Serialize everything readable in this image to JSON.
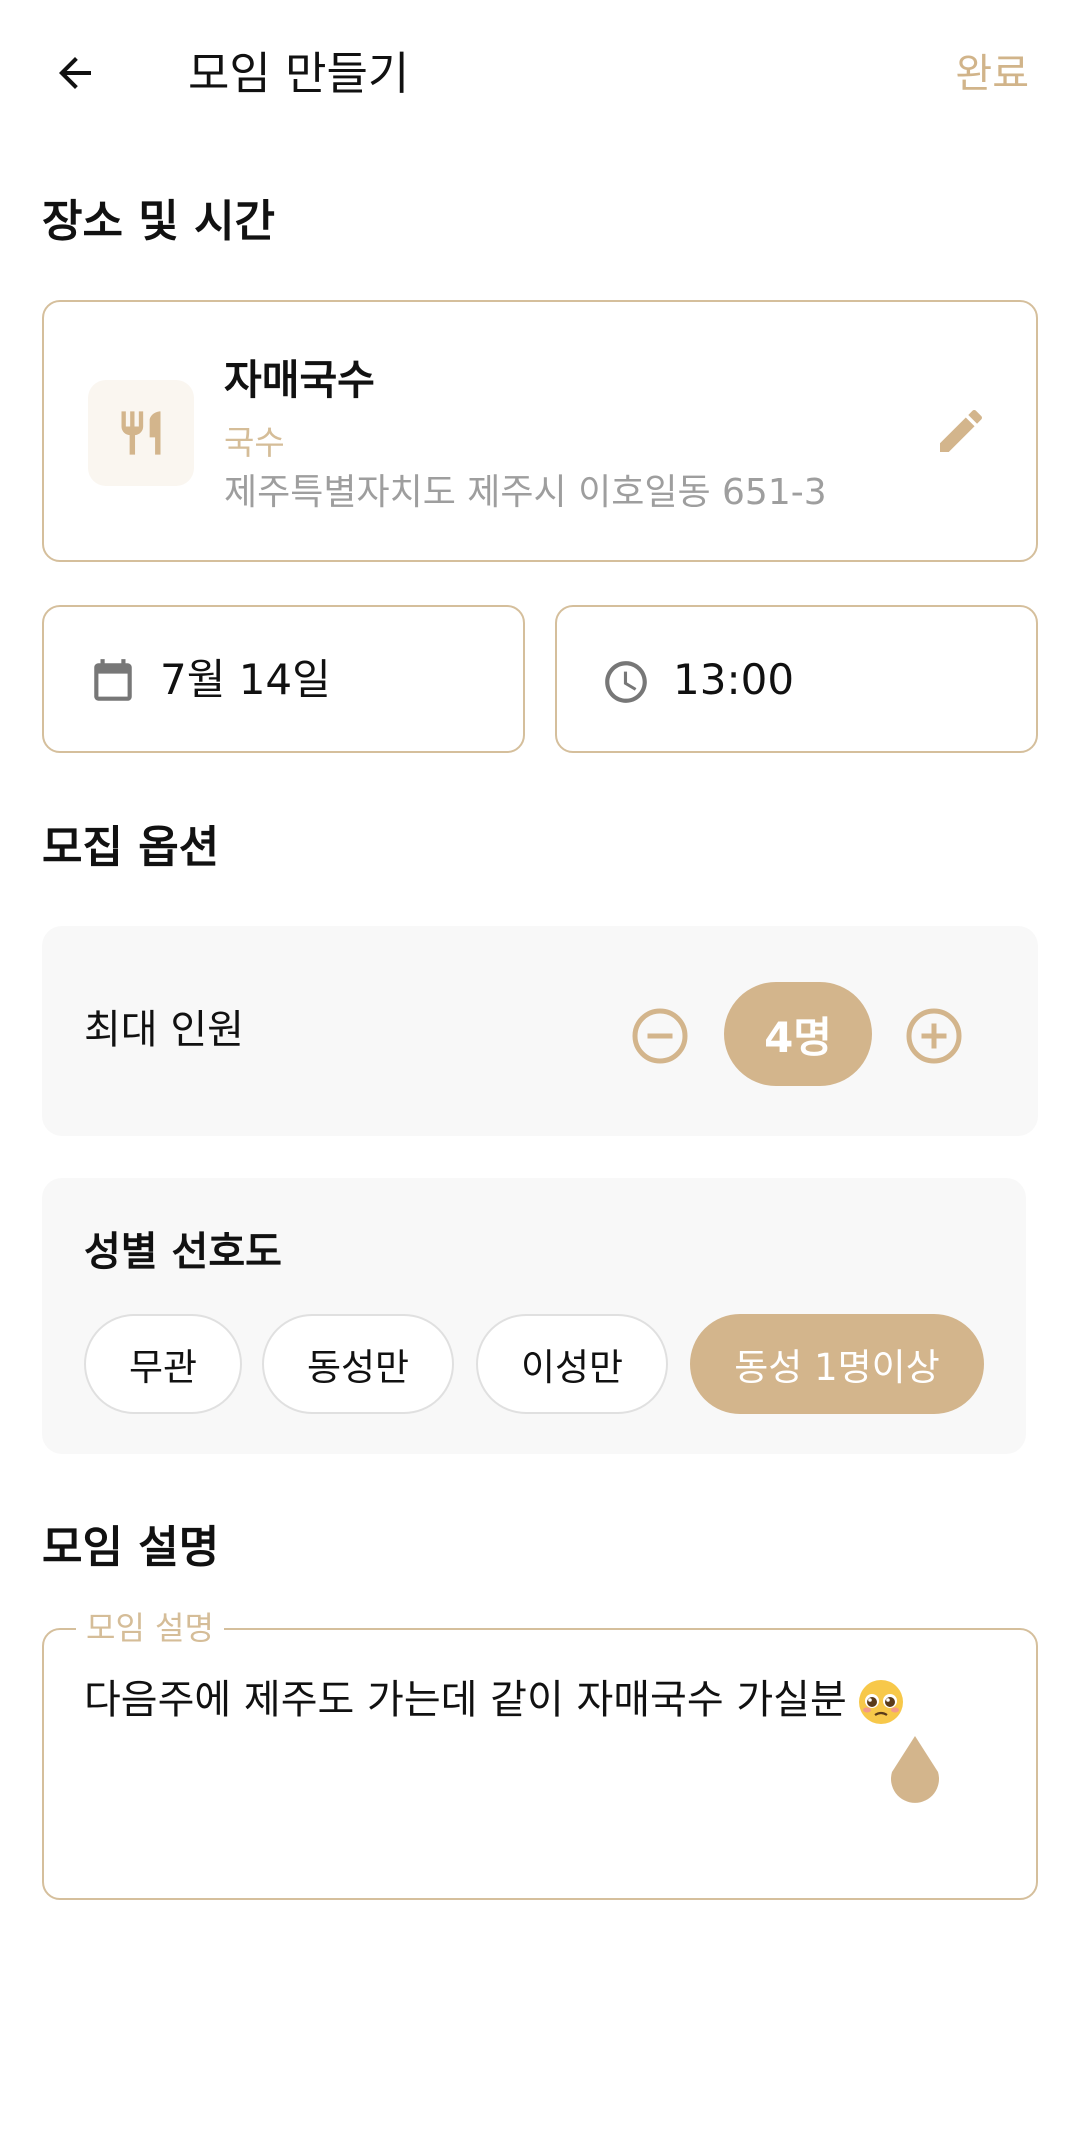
{
  "header": {
    "title": "모임 만들기",
    "done_label": "완료"
  },
  "place_time": {
    "section_title": "장소 및 시간",
    "place": {
      "name": "자매국수",
      "category": "국수",
      "address": "제주특별자치도 제주시 이호일동 651-3"
    },
    "date": "7월 14일",
    "time": "13:00"
  },
  "recruit": {
    "section_title": "모집 옵션",
    "max_people": {
      "label": "최대 인원",
      "value": "4명"
    },
    "gender": {
      "label": "성별 선호도",
      "options": [
        "무관",
        "동성만",
        "이성만",
        "동성 1명이상"
      ],
      "selected": "동성 1명이상"
    }
  },
  "description": {
    "section_title": "모임 설명",
    "field_label": "모임 설명",
    "value": "다음주에 제주도 가는데 같이 자매국수 가실분"
  },
  "icons": {
    "back": "arrow-left-icon",
    "place": "restaurant-icon",
    "edit": "pencil-icon",
    "date": "calendar-icon",
    "time": "clock-icon",
    "minus": "minus-circle-icon",
    "plus": "plus-circle-icon",
    "emoji": "pleading-face-emoji"
  },
  "colors": {
    "accent": "#d3b58c",
    "border": "#d5bf9c",
    "panel_bg": "#f8f8f8",
    "muted_text": "#9e9e9e"
  }
}
